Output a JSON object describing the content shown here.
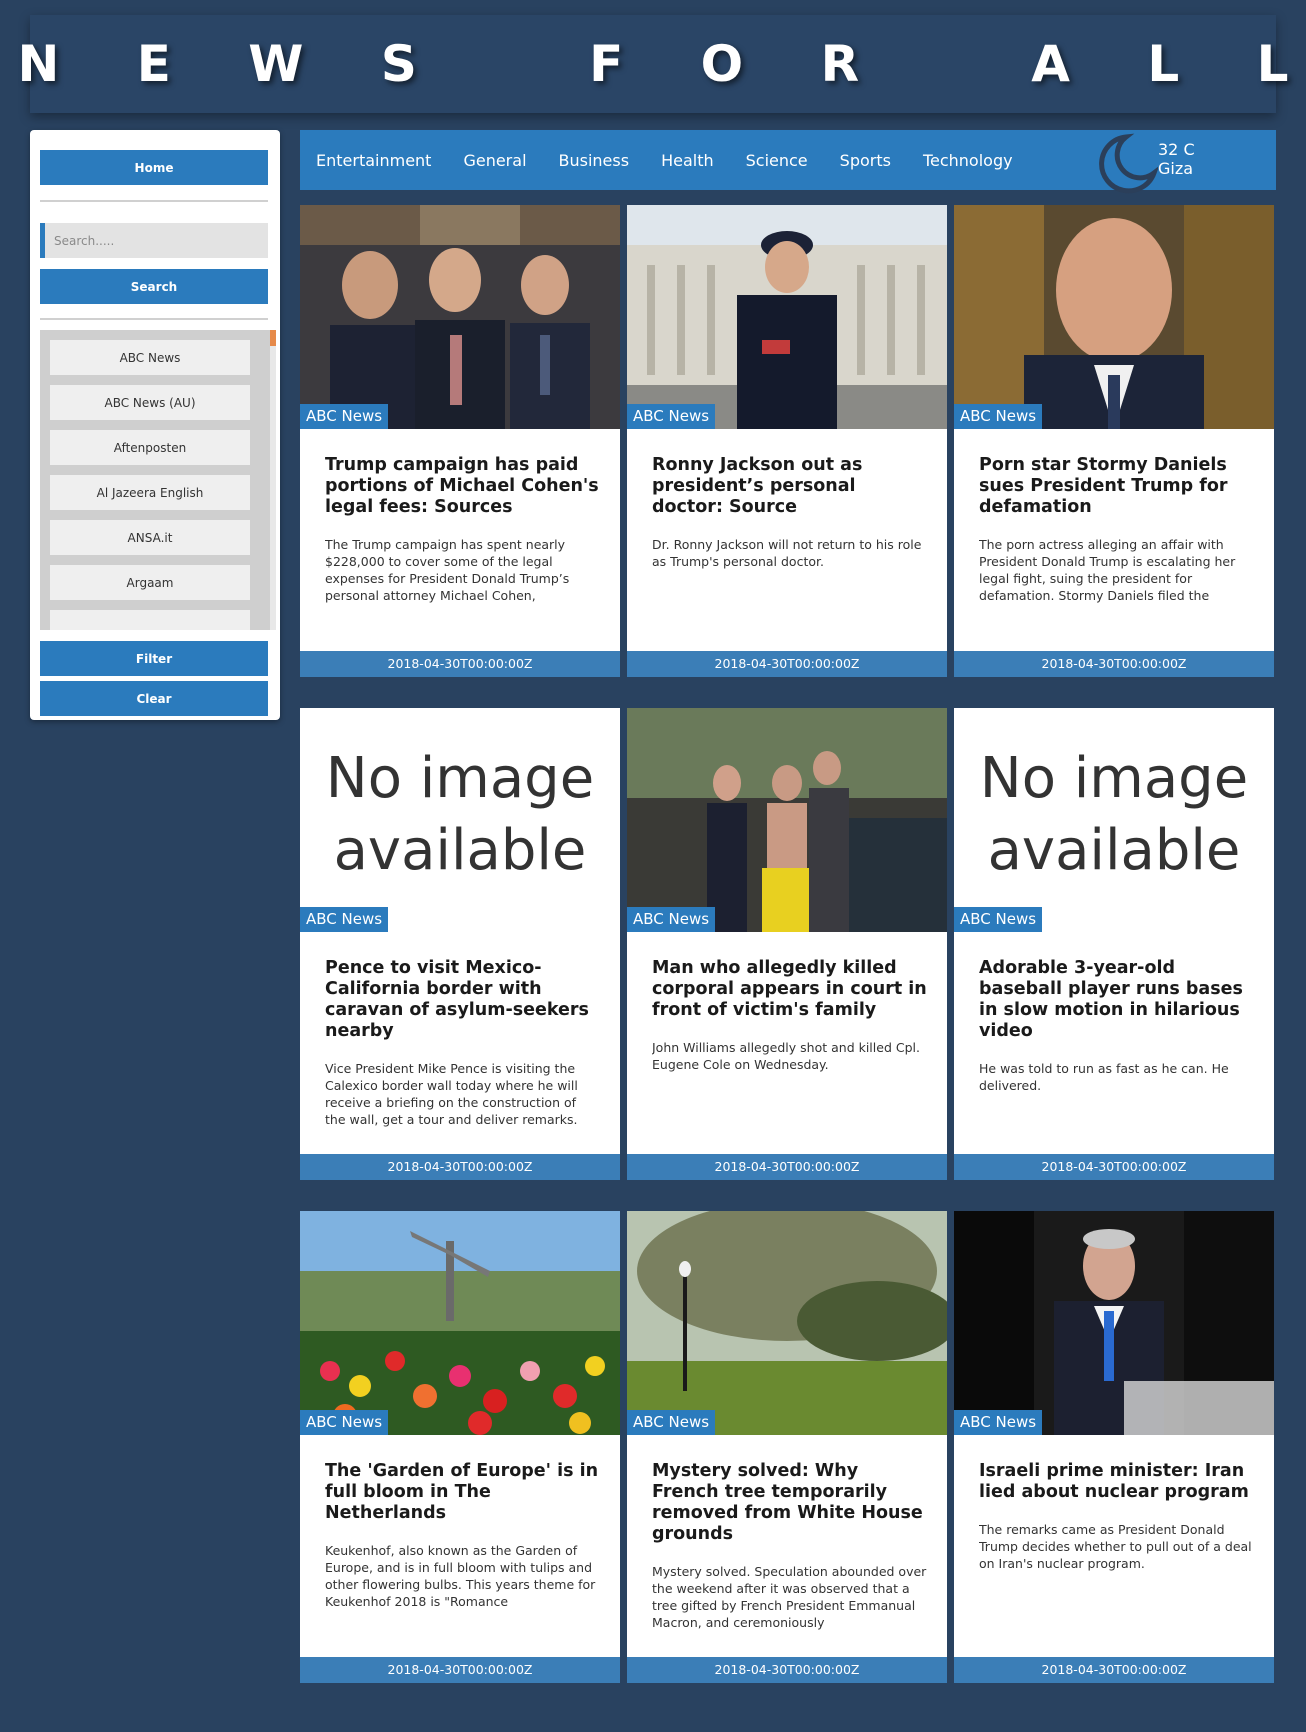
{
  "header": {
    "title": "N E W S   F O R   A L L"
  },
  "sidebar": {
    "home_label": "Home",
    "search_placeholder": "Search.....",
    "search_label": "Search",
    "sources": [
      "ABC News",
      "ABC News (AU)",
      "Aftenposten",
      "Al Jazeera English",
      "ANSA.it",
      "Argaam"
    ],
    "filter_label": "Filter",
    "clear_label": "Clear"
  },
  "nav": {
    "categories": [
      "Entertainment",
      "General",
      "Business",
      "Health",
      "Science",
      "Sports",
      "Technology"
    ]
  },
  "weather": {
    "temp": "32 C",
    "city": "Giza",
    "icon": "moon-icon"
  },
  "articles": [
    {
      "source": "ABC News",
      "title": "Trump campaign has paid portions of Michael Cohen's legal fees: Sources",
      "description": "The Trump campaign has spent nearly $228,000 to cover some of the legal expenses for President Donald Trump’s personal attorney Michael Cohen,",
      "date": "2018-04-30T00:00:00Z",
      "image": "photo"
    },
    {
      "source": "ABC News",
      "title": "Ronny Jackson out as president’s personal doctor: Source",
      "description": "Dr. Ronny Jackson will not return to his role as Trump's personal doctor.",
      "date": "2018-04-30T00:00:00Z",
      "image": "photo"
    },
    {
      "source": "ABC News",
      "title": "Porn star Stormy Daniels sues President Trump for defamation",
      "description": "The porn actress alleging an affair with President Donald Trump is escalating her legal fight, suing the president for defamation. Stormy Daniels filed the",
      "date": "2018-04-30T00:00:00Z",
      "image": "photo"
    },
    {
      "source": "ABC News",
      "title": "Pence to visit Mexico-California border with caravan of asylum-seekers nearby",
      "description": "Vice President Mike Pence is visiting the Calexico border wall today where he will receive a briefing on the construction of the wall, get a tour and deliver remarks.",
      "date": "2018-04-30T00:00:00Z",
      "image": "none",
      "noimg_line1": "No image",
      "noimg_line2": "available"
    },
    {
      "source": "ABC News",
      "title": "Man who allegedly killed corporal appears in court in front of victim's family",
      "description": "John Williams allegedly shot and killed Cpl. Eugene Cole on Wednesday.",
      "date": "2018-04-30T00:00:00Z",
      "image": "photo"
    },
    {
      "source": "ABC News",
      "title": "Adorable 3-year-old baseball player runs bases in slow motion in hilarious video",
      "description": "He was told to run as fast as he can. He delivered.",
      "date": "2018-04-30T00:00:00Z",
      "image": "none",
      "noimg_line1": "No image",
      "noimg_line2": "available"
    },
    {
      "source": "ABC News",
      "title": "The 'Garden of Europe' is in full bloom in The Netherlands",
      "description": "Keukenhof, also known as the Garden of Europe, and is in full bloom with tulips and other flowering bulbs. This years theme for Keukenhof 2018 is \"Romance",
      "date": "2018-04-30T00:00:00Z",
      "image": "photo"
    },
    {
      "source": "ABC News",
      "title": "Mystery solved: Why French tree temporarily removed from White House grounds",
      "description": "Mystery solved. Speculation abounded over the weekend after it was observed that a tree gifted by French President Emmanual Macron, and ceremoniously",
      "date": "2018-04-30T00:00:00Z",
      "image": "photo"
    },
    {
      "source": "ABC News",
      "title": "Israeli prime minister: Iran lied about nuclear program",
      "description": "The remarks came as President Donald Trump decides whether to pull out of a deal on Iran's nuclear program.",
      "date": "2018-04-30T00:00:00Z",
      "image": "photo"
    }
  ],
  "colors": {
    "accent": "#2b7bbd",
    "background": "#294260",
    "header": "#2a4566"
  }
}
